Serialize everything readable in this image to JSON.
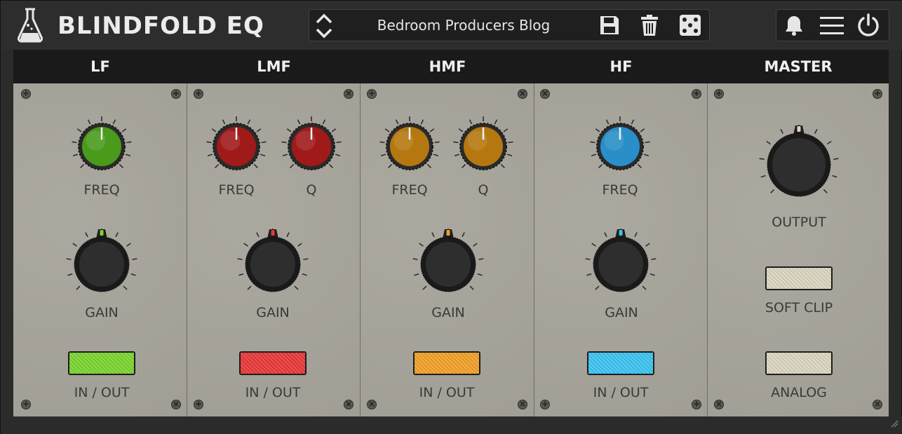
{
  "app": {
    "title": "BLINDFOLD EQ",
    "logo_icon": "flask-icon"
  },
  "preset": {
    "name": "Bedroom Producers Blog",
    "icons": [
      "up-down-arrows-icon",
      "save-icon",
      "trash-icon",
      "dice-icon"
    ]
  },
  "toolbar": {
    "icons": [
      "bell-icon",
      "menu-icon",
      "power-icon"
    ]
  },
  "bands": [
    {
      "title": "LF",
      "knobs": [
        "FREQ"
      ],
      "gain_label": "GAIN",
      "switch_label": "IN / OUT",
      "color": "#4a9a1c",
      "switch_color": "#7ad42e"
    },
    {
      "title": "LMF",
      "knobs": [
        "FREQ",
        "Q"
      ],
      "gain_label": "GAIN",
      "switch_label": "IN / OUT",
      "color": "#a01a1a",
      "switch_color": "#e83838"
    },
    {
      "title": "HMF",
      "knobs": [
        "FREQ",
        "Q"
      ],
      "gain_label": "GAIN",
      "switch_label": "IN / OUT",
      "color": "#b57810",
      "switch_color": "#f0a028"
    },
    {
      "title": "HF",
      "knobs": [
        "FREQ"
      ],
      "gain_label": "GAIN",
      "switch_label": "IN / OUT",
      "color": "#2a8ec8",
      "switch_color": "#3cc4f0"
    }
  ],
  "master": {
    "title": "MASTER",
    "output_label": "OUTPUT",
    "soft_clip_label": "SOFT CLIP",
    "analog_label": "ANALOG",
    "switch_color": "#d8d3bd"
  }
}
